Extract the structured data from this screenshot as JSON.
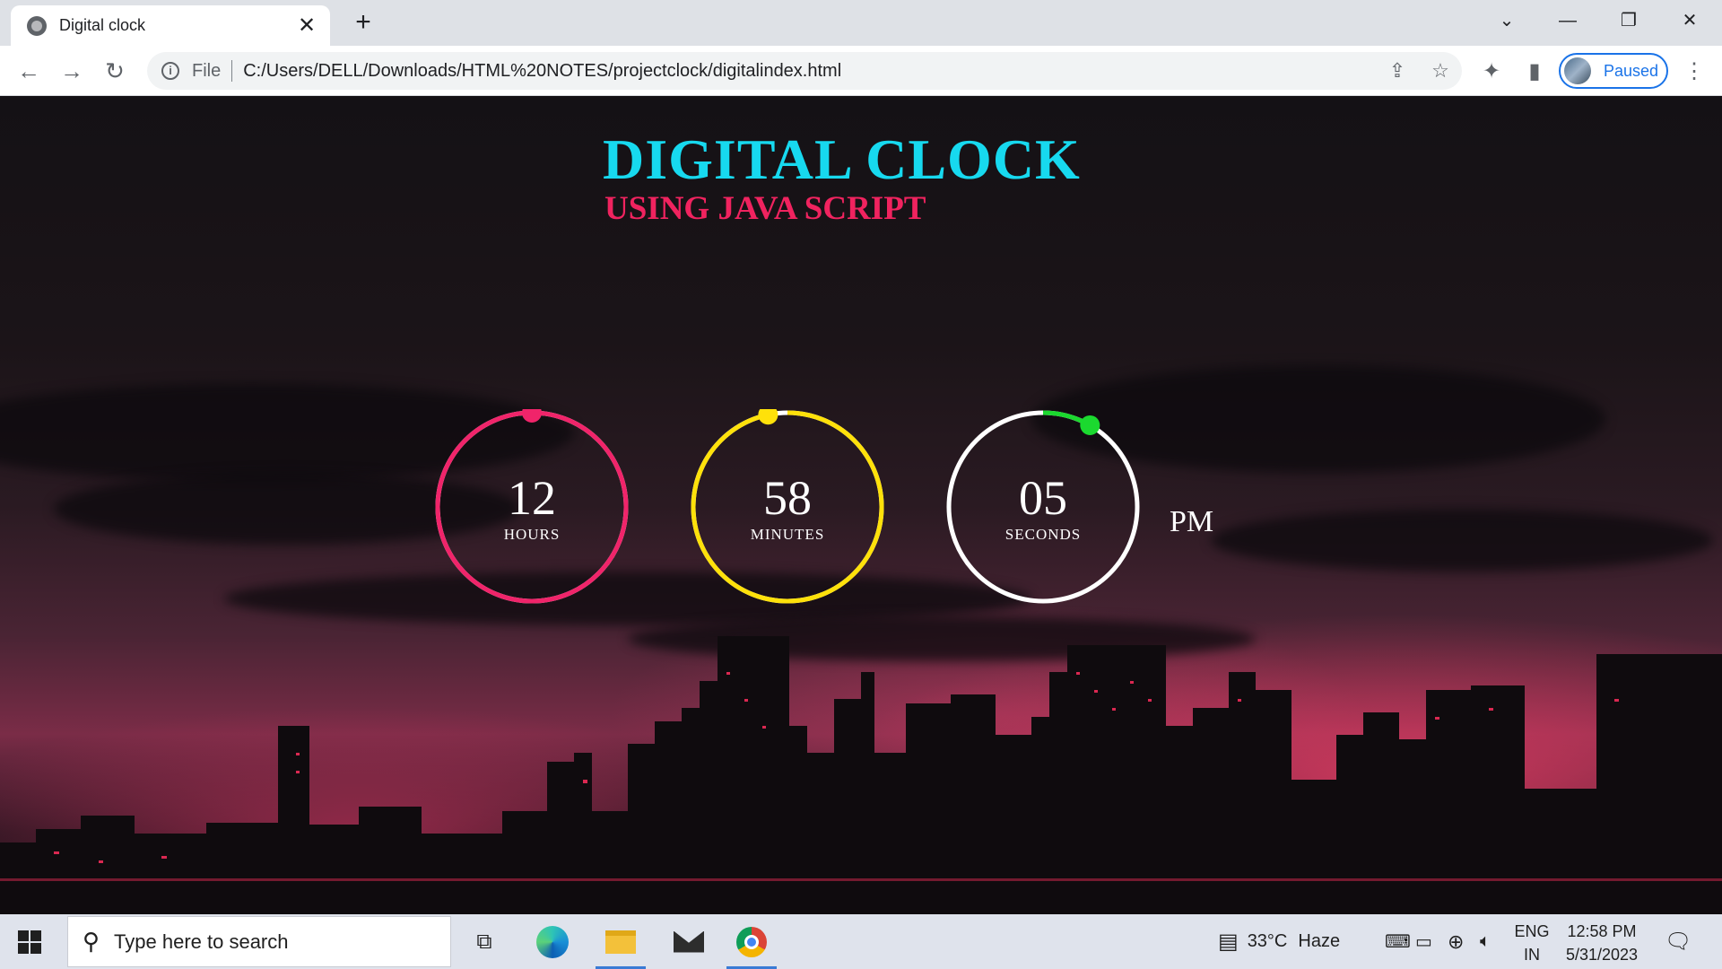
{
  "browser": {
    "tab_title": "Digital clock",
    "new_tab": "+",
    "url_scheme": "File",
    "url": "C:/Users/DELL/Downloads/HTML%20NOTES/projectclock/digitalindex.html",
    "profile_status": "Paused"
  },
  "page": {
    "title": "DIGITAL CLOCK",
    "subtitle": "USING JAVA SCRIPT",
    "ampm": "PM",
    "dials": [
      {
        "value": "12",
        "label": "HOURS",
        "color": "#f0246a",
        "progress": 1.0
      },
      {
        "value": "58",
        "label": "MINUTES",
        "color": "#ffe10a",
        "progress": 0.967
      },
      {
        "value": "05",
        "label": "SECONDS",
        "color": "#1bd92f",
        "progress": 0.083
      }
    ],
    "colors": {
      "title": "#17d9ef",
      "subtitle": "#f0235f"
    }
  },
  "taskbar": {
    "search_placeholder": "Type here to search",
    "weather": "33°C",
    "weather_desc": "Haze",
    "lang_top": "ENG",
    "lang_bottom": "IN",
    "time": "12:58 PM",
    "date": "5/31/2023"
  }
}
